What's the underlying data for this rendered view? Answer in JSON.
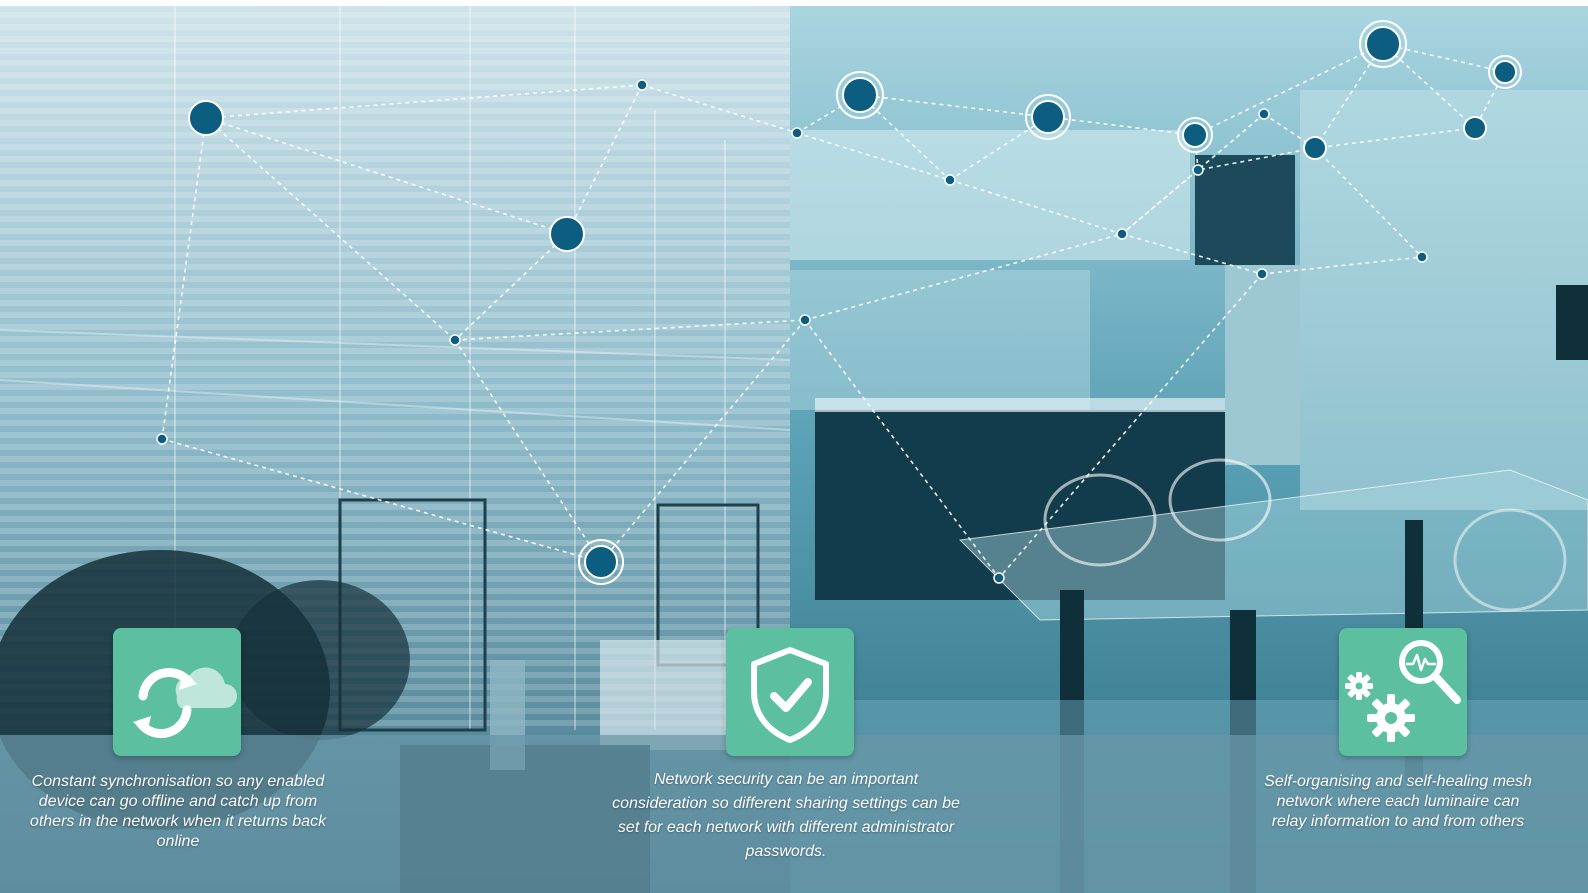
{
  "features": [
    {
      "icon": "cloud-sync-icon",
      "text": "Constant synchronisation so any enabled device can go offline and catch up from others in the network when it returns back online"
    },
    {
      "icon": "shield-check-icon",
      "text": "Network security can be an important consideration so different sharing settings can be set for each network with different administrator passwords."
    },
    {
      "icon": "gears-magnifier-icon",
      "text": "Self-organising and self-healing mesh network where each luminaire can relay information to and from others"
    }
  ],
  "colors": {
    "card": "#5cc0a0",
    "node": "#0d5d80",
    "tint_left": "#5f9cb2",
    "tint_right": "#3f8ea6"
  }
}
